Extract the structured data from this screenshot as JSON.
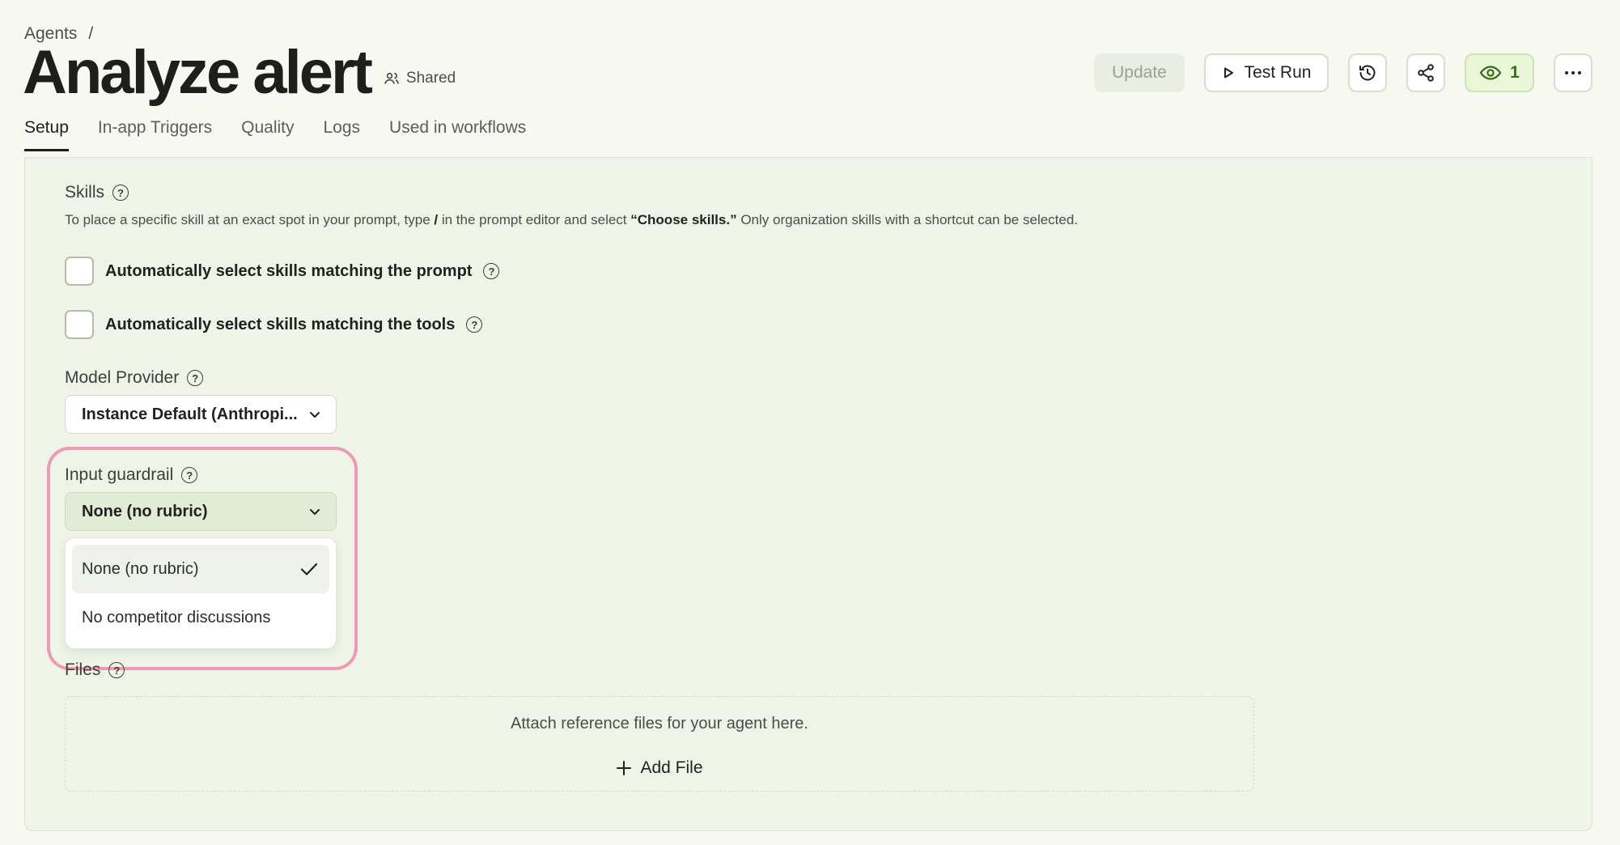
{
  "breadcrumb": {
    "parent": "Agents",
    "separator": "/"
  },
  "header": {
    "title": "Analyze alert",
    "shared_label": "Shared"
  },
  "toolbar": {
    "update_label": "Update",
    "test_run_label": "Test Run",
    "watchers_count": "1"
  },
  "tabs": [
    {
      "label": "Setup",
      "active": true
    },
    {
      "label": "In-app Triggers",
      "active": false
    },
    {
      "label": "Quality",
      "active": false
    },
    {
      "label": "Logs",
      "active": false
    },
    {
      "label": "Used in workflows",
      "active": false
    }
  ],
  "skills": {
    "label": "Skills",
    "hint_pre": "To place a specific skill at an exact spot in your prompt, type ",
    "hint_slash": "/",
    "hint_mid": " in the prompt editor and select ",
    "hint_choose": "“Choose skills.”",
    "hint_post": " Only organization skills with a shortcut can be selected.",
    "auto_prompt_label": "Automatically select skills matching the prompt",
    "auto_tools_label": "Automatically select skills matching the tools"
  },
  "model_provider": {
    "label": "Model Provider",
    "value": "Instance Default (Anthropi..."
  },
  "input_guardrail": {
    "label": "Input guardrail",
    "value": "None (no rubric)",
    "options": [
      {
        "label": "None (no rubric)",
        "selected": true
      },
      {
        "label": "No competitor discussions",
        "selected": false
      }
    ]
  },
  "files": {
    "label": "Files",
    "dropzone_text": "Attach reference files for your agent here.",
    "add_label": "Add File"
  },
  "colors": {
    "accent_highlight": "#ea9bb6",
    "watch_badge_bg": "#e9f6d8",
    "panel_bg": "#eff3e8"
  }
}
